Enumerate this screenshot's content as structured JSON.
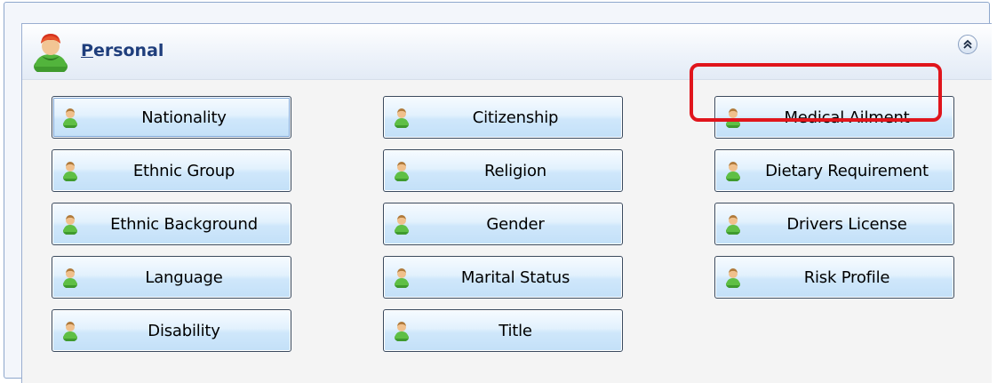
{
  "section": {
    "title": "Personal",
    "title_hotkey": "P",
    "title_rest": "ersonal"
  },
  "columns": [
    [
      "Nationality",
      "Ethnic Group",
      "Ethnic Background",
      "Language",
      "Disability"
    ],
    [
      "Citizenship",
      "Religion",
      "Gender",
      "Marital Status",
      "Title"
    ],
    [
      "Medical Ailment",
      "Dietary Requirement",
      "Drivers License",
      "Risk Profile"
    ]
  ],
  "focused_button": "Nationality",
  "highlighted_button": "Medical Ailment",
  "icons": {
    "section_icon": "person-icon",
    "button_icon": "person-icon",
    "collapse_icon": "double-chevron-up-icon"
  },
  "colors": {
    "highlight": "#e0151c",
    "title": "#1f3e7c",
    "button_top": "#f6fbff",
    "button_bottom": "#c3e0f8"
  }
}
